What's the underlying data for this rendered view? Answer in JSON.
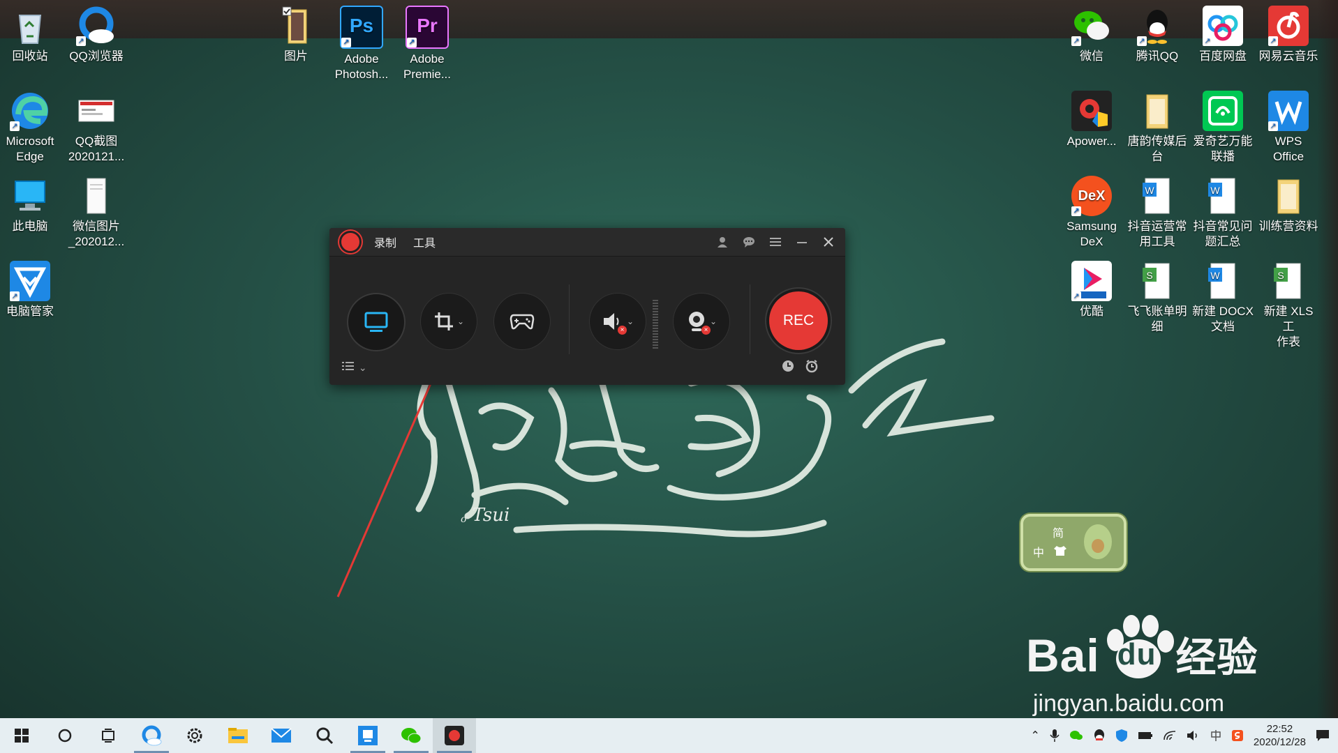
{
  "desktop": {
    "left_icons": [
      {
        "label": "回收站",
        "icon": "recycle-bin-icon"
      },
      {
        "label": "QQ浏览器",
        "icon": "qq-browser-icon"
      },
      {
        "label": "Microsoft\nEdge",
        "icon": "edge-icon"
      },
      {
        "label": "QQ截图\n2020121...",
        "icon": "screenshot-file-icon"
      },
      {
        "label": "此电脑",
        "icon": "this-pc-icon"
      },
      {
        "label": "微信图片\n_202012...",
        "icon": "image-file-icon"
      },
      {
        "label": "电脑管家",
        "icon": "pc-manager-icon"
      }
    ],
    "top_icons": [
      {
        "label": "图片",
        "icon": "folder-icon"
      },
      {
        "label": "Adobe\nPhotosh...",
        "icon": "photoshop-icon",
        "badge": "Ps"
      },
      {
        "label": "Adobe\nPremie...",
        "icon": "premiere-icon",
        "badge": "Pr"
      }
    ],
    "right_icons": [
      {
        "label": "微信",
        "icon": "wechat-icon"
      },
      {
        "label": "腾讯QQ",
        "icon": "qq-icon"
      },
      {
        "label": "百度网盘",
        "icon": "baidu-netdisk-icon"
      },
      {
        "label": "网易云音乐",
        "icon": "netease-music-icon"
      },
      {
        "label": "Apower...",
        "icon": "apowerrec-icon"
      },
      {
        "label": "唐韵传媒后\n台",
        "icon": "folder-icon"
      },
      {
        "label": "爱奇艺万能\n联播",
        "icon": "iqiyi-icon"
      },
      {
        "label": "WPS\nOffice",
        "icon": "wps-icon"
      },
      {
        "label": "Samsung\nDeX",
        "icon": "samsung-dex-icon",
        "badge": "DeX"
      },
      {
        "label": "抖音运营常\n用工具",
        "icon": "word-doc-icon"
      },
      {
        "label": "抖音常见问\n题汇总",
        "icon": "word-doc-icon"
      },
      {
        "label": "训练营资料",
        "icon": "folder-icon"
      },
      {
        "label": "优酷",
        "icon": "youku-icon"
      },
      {
        "label": "飞飞账单明\n细",
        "icon": "spreadsheet-icon"
      },
      {
        "label": "新建 DOCX\n文档",
        "icon": "word-doc-icon"
      },
      {
        "label": "新建 XLS 工\n作表",
        "icon": "spreadsheet-icon"
      }
    ]
  },
  "recorder": {
    "menu": [
      "录制",
      "工具"
    ],
    "rec_label": "REC"
  },
  "ime_widget": {
    "line1": "简",
    "line2": "中"
  },
  "wallpaper": {
    "signature": "Tsui"
  },
  "watermark": {
    "brand": "Bai",
    "brand2": "du",
    "brand_cn": "经验",
    "url": "jingyan.baidu.com"
  },
  "taskbar": {
    "apps": [
      "start-icon",
      "search-circle-icon",
      "task-view-icon",
      "browser-icon",
      "settings-icon",
      "file-explorer-icon",
      "mail-icon",
      "search-app-icon",
      "screenshot-app-icon",
      "wechat-icon",
      "recorder-icon"
    ],
    "time": "22:52",
    "date": "2020/12/28"
  },
  "colors": {
    "accent_red": "#e53935",
    "taskbar_bg": "#e6eef2"
  }
}
